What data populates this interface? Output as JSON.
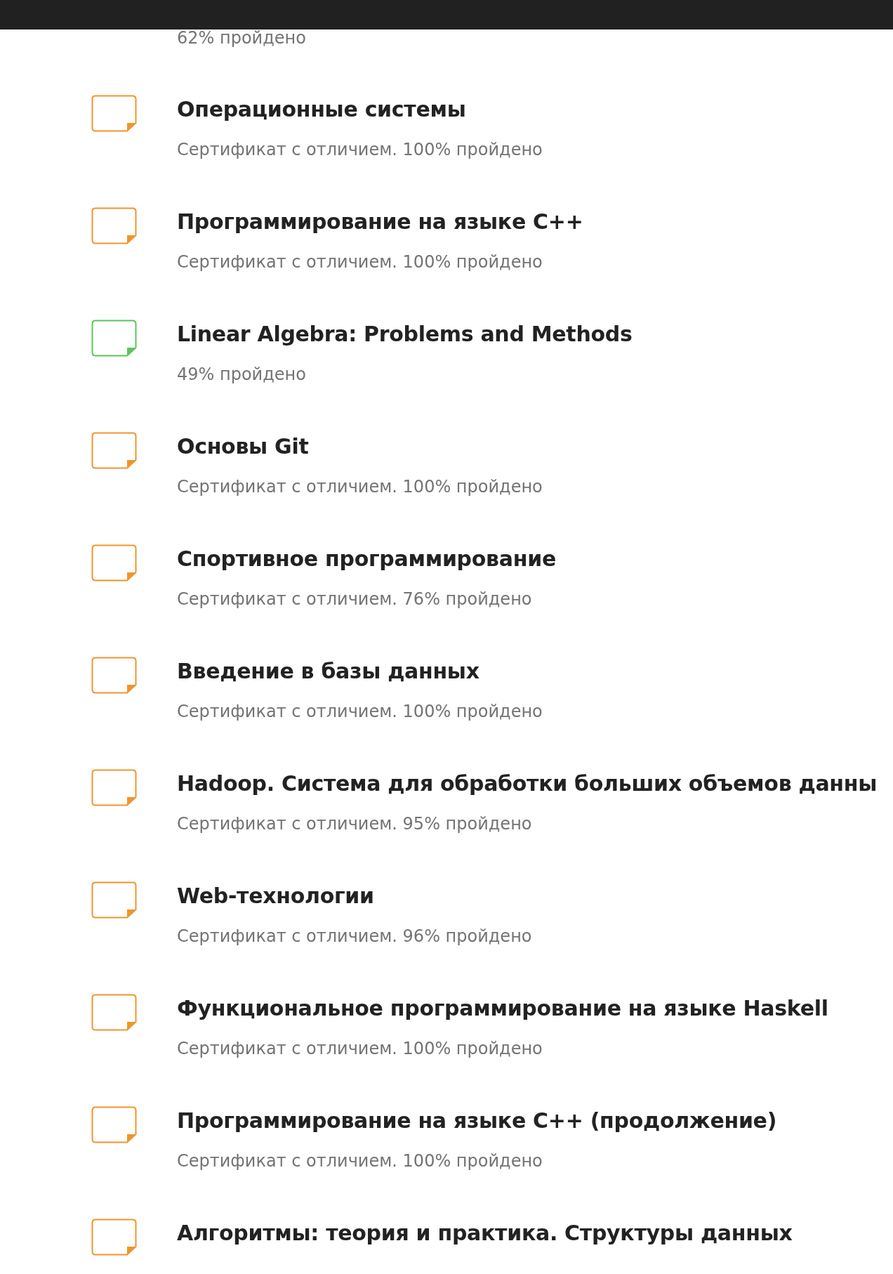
{
  "courses": [
    {
      "subtitle": "62% пройдено"
    },
    {
      "title": "Операционные системы",
      "subtitle": "Сертификат с отличием. 100% пройдено",
      "color": "#f0952a"
    },
    {
      "title": "Программирование на языке C++",
      "subtitle": "Сертификат с отличием. 100% пройдено",
      "color": "#f0952a"
    },
    {
      "title": "Linear Algebra: Problems and Methods",
      "subtitle": "49% пройдено",
      "color": "#5cc55a"
    },
    {
      "title": "Основы Git",
      "subtitle": "Сертификат с отличием. 100% пройдено",
      "color": "#f0952a"
    },
    {
      "title": "Спортивное программирование",
      "subtitle": "Сертификат с отличием. 76% пройдено",
      "color": "#f0952a"
    },
    {
      "title": "Введение в базы данных",
      "subtitle": "Сертификат с отличием. 100% пройдено",
      "color": "#f0952a"
    },
    {
      "title": "Hadoop. Система для обработки больших объемов данны",
      "subtitle": "Сертификат с отличием. 95% пройдено",
      "color": "#f0952a"
    },
    {
      "title": "Web-технологии",
      "subtitle": "Сертификат с отличием. 96% пройдено",
      "color": "#f0952a"
    },
    {
      "title": "Функциональное программирование на языке Haskell",
      "subtitle": "Сертификат с отличием. 100% пройдено",
      "color": "#f0952a"
    },
    {
      "title": "Программирование на языке C++ (продолжение)",
      "subtitle": "Сертификат с отличием. 100% пройдено",
      "color": "#f0952a"
    },
    {
      "title": "Алгоритмы: теория и практика. Структуры данных",
      "color": "#f0952a"
    }
  ]
}
